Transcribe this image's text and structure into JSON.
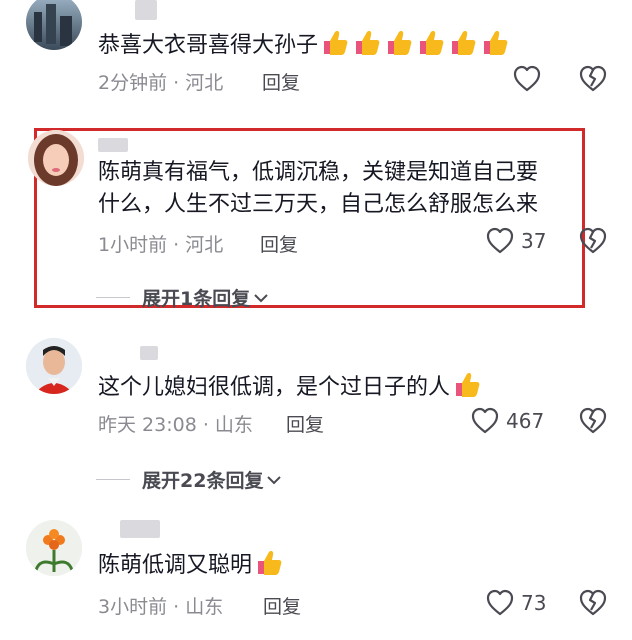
{
  "comments": [
    {
      "text": "恭喜大衣哥喜得大孙子",
      "thumbs_count": 6,
      "meta": "2分钟前 · 河北",
      "reply_label": "回复",
      "like_count": ""
    },
    {
      "text_line1": "陈萌真有福气，低调沉稳，关键是知道自己要",
      "text_line2": "什么，人生不过三万天，自己怎么舒服怎么来",
      "meta": "1小时前 · 河北",
      "reply_label": "回复",
      "like_count": "37",
      "expand_label": "展开1条回复"
    },
    {
      "text": "这个儿媳妇很低调，是个过日子的人",
      "meta": "昨天 23:08 · 山东",
      "reply_label": "回复",
      "like_count": "467",
      "expand_label": "展开22条回复"
    },
    {
      "text": "陈萌低调又聪明",
      "meta": "3小时前 · 山东",
      "reply_label": "回复",
      "like_count": "73"
    }
  ],
  "colors": {
    "highlight_border": "#d22a2a",
    "meta_text": "#8a8b91",
    "thumb_yellow": "#f7b91c"
  },
  "icons": [
    "heart-outline-icon",
    "broken-heart-icon",
    "thumbs-up-emoji-icon",
    "chevron-down-icon"
  ]
}
